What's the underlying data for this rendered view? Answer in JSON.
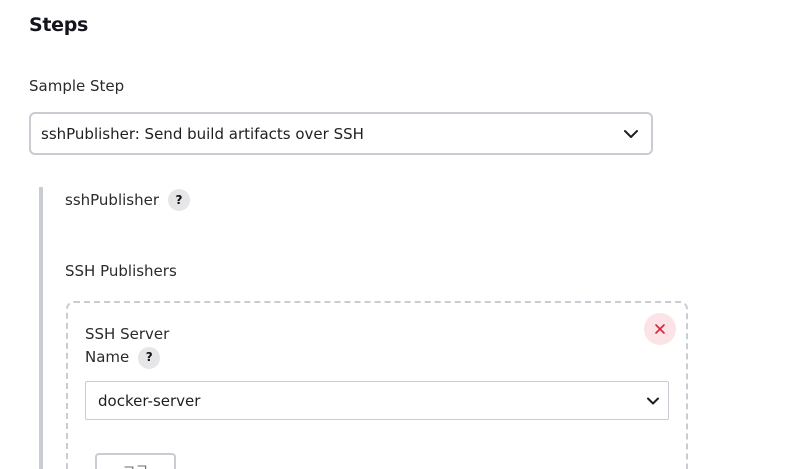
{
  "steps": {
    "title": "Steps",
    "sample_step_label": "Sample Step",
    "sample_step_value": "sshPublisher: Send build artifacts over SSH"
  },
  "ssh_publisher": {
    "label": "sshPublisher",
    "help": "?",
    "publishers_label": "SSH Publishers",
    "server": {
      "label_line1": "SSH Server",
      "label_line2": "Name",
      "help": "?",
      "name_value": "docker-server"
    },
    "advanced_button": "고급"
  },
  "colors": {
    "border": "#c9ccd2",
    "danger": "#d9243c",
    "danger_bg": "#fbe3e6"
  },
  "icons": [
    "chevron-down-icon",
    "close-icon",
    "help-icon"
  ]
}
